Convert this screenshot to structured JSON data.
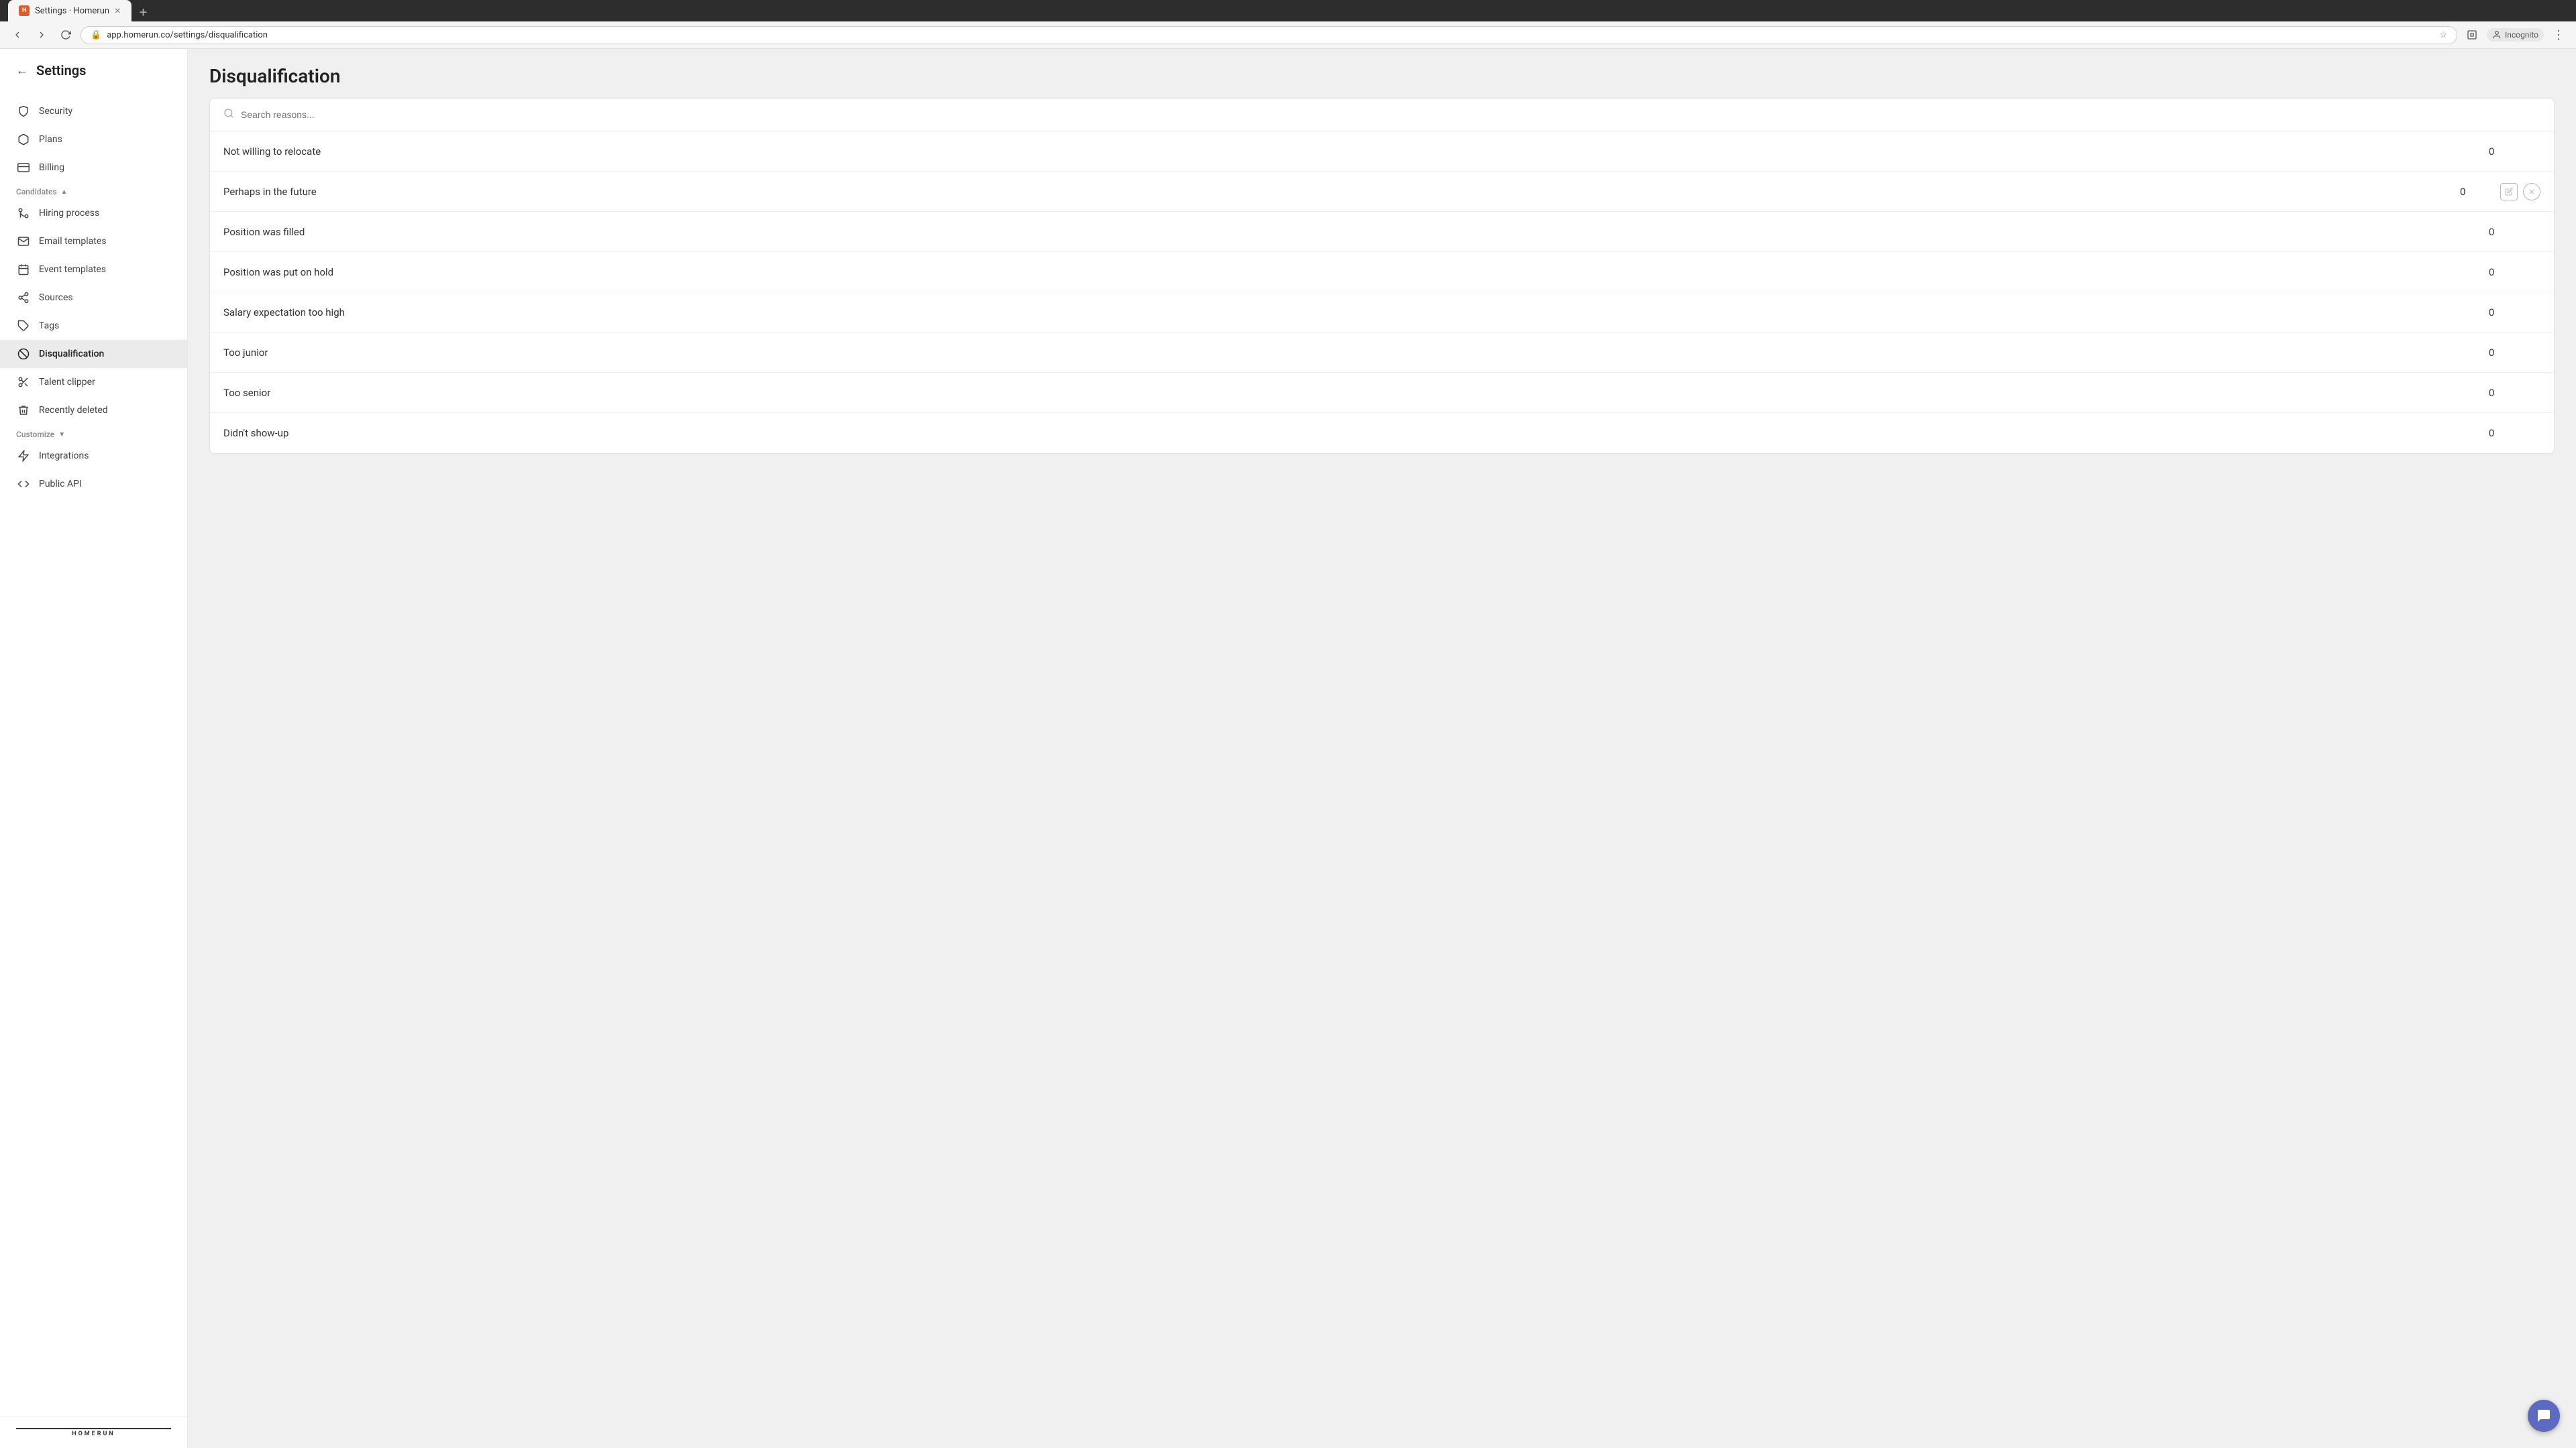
{
  "browser": {
    "tab_title": "Settings · Homerun",
    "url": "app.homerun.co/settings/disqualification",
    "incognito_label": "Incognito"
  },
  "sidebar": {
    "back_label": "←",
    "title": "Settings",
    "sections": [
      {
        "id": "top",
        "items": [
          {
            "id": "security",
            "label": "Security",
            "icon": "shield"
          },
          {
            "id": "plans",
            "label": "Plans",
            "icon": "box"
          },
          {
            "id": "billing",
            "label": "Billing",
            "icon": "credit-card"
          }
        ]
      },
      {
        "id": "candidates",
        "label": "Candidates",
        "items": [
          {
            "id": "hiring-process",
            "label": "Hiring process",
            "icon": "git-branch"
          },
          {
            "id": "email-templates",
            "label": "Email templates",
            "icon": "mail"
          },
          {
            "id": "event-templates",
            "label": "Event templates",
            "icon": "calendar"
          },
          {
            "id": "sources",
            "label": "Sources",
            "icon": "share-2"
          },
          {
            "id": "tags",
            "label": "Tags",
            "icon": "tag"
          },
          {
            "id": "disqualification",
            "label": "Disqualification",
            "icon": "slash",
            "active": true
          },
          {
            "id": "talent-clipper",
            "label": "Talent clipper",
            "icon": "scissors"
          },
          {
            "id": "recently-deleted",
            "label": "Recently deleted",
            "icon": "trash"
          }
        ]
      },
      {
        "id": "customize",
        "label": "Customize",
        "items": [
          {
            "id": "integrations",
            "label": "Integrations",
            "icon": "zap"
          },
          {
            "id": "public-api",
            "label": "Public API",
            "icon": "code"
          }
        ]
      }
    ],
    "logo": "HOMERUN"
  },
  "main": {
    "title": "Disqualification",
    "search_placeholder": "Search reasons...",
    "rows": [
      {
        "id": 1,
        "label": "Not willing to relocate",
        "count": "0",
        "actions": "more"
      },
      {
        "id": 2,
        "label": "Perhaps in the future",
        "count": "0",
        "actions": "edit-delete",
        "hover": true
      },
      {
        "id": 3,
        "label": "Position was filled",
        "count": "0",
        "actions": "more"
      },
      {
        "id": 4,
        "label": "Position was put on hold",
        "count": "0",
        "actions": "more"
      },
      {
        "id": 5,
        "label": "Salary expectation too high",
        "count": "0",
        "actions": "more"
      },
      {
        "id": 6,
        "label": "Too junior",
        "count": "0",
        "actions": "more"
      },
      {
        "id": 7,
        "label": "Too senior",
        "count": "0",
        "actions": "more"
      },
      {
        "id": 8,
        "label": "Didn't show-up",
        "count": "0",
        "actions": "more"
      }
    ]
  }
}
